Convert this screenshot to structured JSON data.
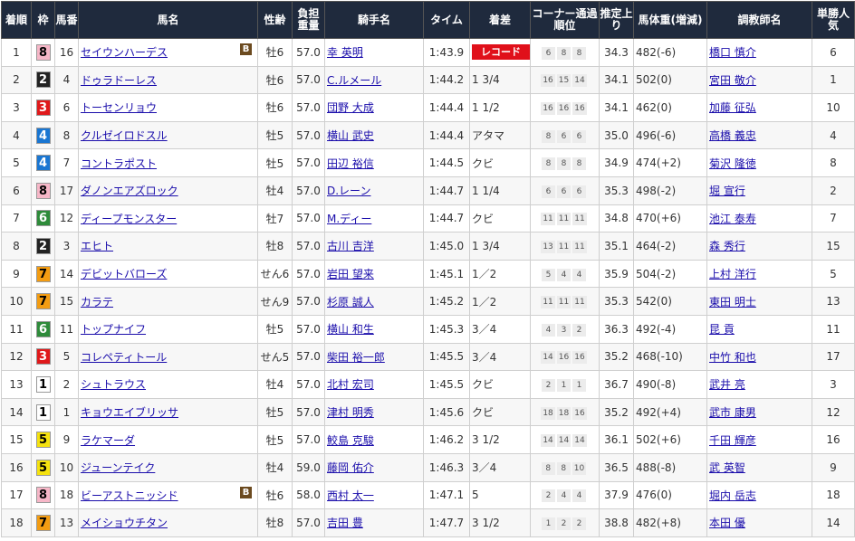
{
  "headers": {
    "finish": "着順",
    "frame": "枠",
    "number": "馬番",
    "horse": "馬名",
    "sexage": "性齢",
    "weight": "負担重量",
    "jockey": "騎手名",
    "time": "タイム",
    "margin": "着差",
    "corner": "コーナー通過順位",
    "last3f": "推定上り",
    "body_weight": "馬体重(増減)",
    "trainer": "調教師名",
    "odds_rank": "単勝人気"
  },
  "frame_colors": {
    "1": {
      "bg": "#ffffff",
      "fg": "#000000"
    },
    "2": {
      "bg": "#222222",
      "fg": "#ffffff"
    },
    "3": {
      "bg": "#e0191b",
      "fg": "#ffffff"
    },
    "4": {
      "bg": "#1976d2",
      "fg": "#ffffff"
    },
    "5": {
      "bg": "#f5e20f",
      "fg": "#000000"
    },
    "6": {
      "bg": "#2e8b3a",
      "fg": "#ffffff"
    },
    "7": {
      "bg": "#f39c12",
      "fg": "#000000"
    },
    "8": {
      "bg": "#f7b7c8",
      "fg": "#000000"
    }
  },
  "rows": [
    {
      "finish": "1",
      "frame": "8",
      "number": "16",
      "horse": "セイウンハーデス",
      "blinker": "B",
      "sexage": "牡6",
      "weight": "57.0",
      "jockey": "幸 英明",
      "time": "1:43.9",
      "margin": "レコード",
      "margin_badge": true,
      "corner": [
        "6",
        "8",
        "8"
      ],
      "last3f": "34.3",
      "body_weight": "482(-6)",
      "trainer": "橋口 慎介",
      "odds_rank": "6"
    },
    {
      "finish": "2",
      "frame": "2",
      "number": "4",
      "horse": "ドゥラドーレス",
      "sexage": "牡6",
      "weight": "57.0",
      "jockey": "C.ルメール",
      "time": "1:44.2",
      "margin": "1 3/4",
      "corner": [
        "16",
        "15",
        "14"
      ],
      "last3f": "34.1",
      "body_weight": "502(0)",
      "trainer": "宮田 敬介",
      "odds_rank": "1"
    },
    {
      "finish": "3",
      "frame": "3",
      "number": "6",
      "horse": "トーセンリョウ",
      "sexage": "牡6",
      "weight": "57.0",
      "jockey": "団野 大成",
      "time": "1:44.4",
      "margin": "1 1/2",
      "corner": [
        "16",
        "16",
        "16"
      ],
      "last3f": "34.1",
      "body_weight": "462(0)",
      "trainer": "加藤 征弘",
      "odds_rank": "10"
    },
    {
      "finish": "4",
      "frame": "4",
      "number": "8",
      "horse": "クルゼイロドスル",
      "sexage": "牡5",
      "weight": "57.0",
      "jockey": "横山 武史",
      "time": "1:44.4",
      "margin": "アタマ",
      "corner": [
        "8",
        "6",
        "6"
      ],
      "last3f": "35.0",
      "body_weight": "496(-6)",
      "trainer": "高橋 義忠",
      "odds_rank": "4"
    },
    {
      "finish": "5",
      "frame": "4",
      "number": "7",
      "horse": "コントラポスト",
      "sexage": "牡5",
      "weight": "57.0",
      "jockey": "田辺 裕信",
      "time": "1:44.5",
      "margin": "クビ",
      "corner": [
        "8",
        "8",
        "8"
      ],
      "last3f": "34.9",
      "body_weight": "474(+2)",
      "trainer": "菊沢 隆徳",
      "odds_rank": "8"
    },
    {
      "finish": "6",
      "frame": "8",
      "number": "17",
      "horse": "ダノンエアズロック",
      "sexage": "牡4",
      "weight": "57.0",
      "jockey": "D.レーン",
      "time": "1:44.7",
      "margin": "1 1/4",
      "corner": [
        "6",
        "6",
        "6"
      ],
      "last3f": "35.3",
      "body_weight": "498(-2)",
      "trainer": "堀 宣行",
      "odds_rank": "2"
    },
    {
      "finish": "7",
      "frame": "6",
      "number": "12",
      "horse": "ディープモンスター",
      "sexage": "牡7",
      "weight": "57.0",
      "jockey": "M.ディー",
      "time": "1:44.7",
      "margin": "クビ",
      "corner": [
        "11",
        "11",
        "11"
      ],
      "last3f": "34.8",
      "body_weight": "470(+6)",
      "trainer": "池江 泰寿",
      "odds_rank": "7"
    },
    {
      "finish": "8",
      "frame": "2",
      "number": "3",
      "horse": "エヒト",
      "sexage": "牡8",
      "weight": "57.0",
      "jockey": "古川 吉洋",
      "time": "1:45.0",
      "margin": "1 3/4",
      "corner": [
        "13",
        "11",
        "11"
      ],
      "last3f": "35.1",
      "body_weight": "464(-2)",
      "trainer": "森 秀行",
      "odds_rank": "15"
    },
    {
      "finish": "9",
      "frame": "7",
      "number": "14",
      "horse": "デビットバローズ",
      "sexage": "せん6",
      "weight": "57.0",
      "jockey": "岩田 望来",
      "time": "1:45.1",
      "margin": "1／2",
      "corner": [
        "5",
        "4",
        "4"
      ],
      "last3f": "35.9",
      "body_weight": "504(-2)",
      "trainer": "上村 洋行",
      "odds_rank": "5"
    },
    {
      "finish": "10",
      "frame": "7",
      "number": "15",
      "horse": "カラテ",
      "sexage": "せん9",
      "weight": "57.0",
      "jockey": "杉原 誠人",
      "time": "1:45.2",
      "margin": "1／2",
      "corner": [
        "11",
        "11",
        "11"
      ],
      "last3f": "35.3",
      "body_weight": "542(0)",
      "trainer": "東田 明士",
      "odds_rank": "13"
    },
    {
      "finish": "11",
      "frame": "6",
      "number": "11",
      "horse": "トップナイフ",
      "sexage": "牡5",
      "weight": "57.0",
      "jockey": "横山 和生",
      "time": "1:45.3",
      "margin": "3／4",
      "corner": [
        "4",
        "3",
        "2"
      ],
      "last3f": "36.3",
      "body_weight": "492(-4)",
      "trainer": "昆 貢",
      "odds_rank": "11"
    },
    {
      "finish": "12",
      "frame": "3",
      "number": "5",
      "horse": "コレペティトール",
      "sexage": "せん5",
      "weight": "57.0",
      "jockey": "柴田 裕一郎",
      "time": "1:45.5",
      "margin": "3／4",
      "corner": [
        "14",
        "16",
        "16"
      ],
      "last3f": "35.2",
      "body_weight": "468(-10)",
      "trainer": "中竹 和也",
      "odds_rank": "17"
    },
    {
      "finish": "13",
      "frame": "1",
      "number": "2",
      "horse": "シュトラウス",
      "sexage": "牡4",
      "weight": "57.0",
      "jockey": "北村 宏司",
      "time": "1:45.5",
      "margin": "クビ",
      "corner": [
        "2",
        "1",
        "1"
      ],
      "last3f": "36.7",
      "body_weight": "490(-8)",
      "trainer": "武井 亮",
      "odds_rank": "3"
    },
    {
      "finish": "14",
      "frame": "1",
      "number": "1",
      "horse": "キョウエイブリッサ",
      "sexage": "牡5",
      "weight": "57.0",
      "jockey": "津村 明秀",
      "time": "1:45.6",
      "margin": "クビ",
      "corner": [
        "18",
        "18",
        "16"
      ],
      "last3f": "35.2",
      "body_weight": "492(+4)",
      "trainer": "武市 康男",
      "odds_rank": "12"
    },
    {
      "finish": "15",
      "frame": "5",
      "number": "9",
      "horse": "ラケマーダ",
      "sexage": "牡5",
      "weight": "57.0",
      "jockey": "鮫島 克駿",
      "time": "1:46.2",
      "margin": "3 1/2",
      "corner": [
        "14",
        "14",
        "14"
      ],
      "last3f": "36.1",
      "body_weight": "502(+6)",
      "trainer": "千田 輝彦",
      "odds_rank": "16"
    },
    {
      "finish": "16",
      "frame": "5",
      "number": "10",
      "horse": "ジューンテイク",
      "sexage": "牡4",
      "weight": "59.0",
      "jockey": "藤岡 佑介",
      "time": "1:46.3",
      "margin": "3／4",
      "corner": [
        "8",
        "8",
        "10"
      ],
      "last3f": "36.5",
      "body_weight": "488(-8)",
      "trainer": "武 英智",
      "odds_rank": "9"
    },
    {
      "finish": "17",
      "frame": "8",
      "number": "18",
      "horse": "ビーアストニッシド",
      "blinker": "B",
      "sexage": "牡6",
      "weight": "58.0",
      "jockey": "西村 太一",
      "time": "1:47.1",
      "margin": "5",
      "corner": [
        "2",
        "4",
        "4"
      ],
      "last3f": "37.9",
      "body_weight": "476(0)",
      "trainer": "堀内 岳志",
      "odds_rank": "18"
    },
    {
      "finish": "18",
      "frame": "7",
      "number": "13",
      "horse": "メイショウチタン",
      "sexage": "牡8",
      "weight": "57.0",
      "jockey": "吉田 豊",
      "time": "1:47.7",
      "margin": "3 1/2",
      "corner": [
        "1",
        "2",
        "2"
      ],
      "last3f": "38.8",
      "body_weight": "482(+8)",
      "trainer": "本田 優",
      "odds_rank": "14"
    }
  ]
}
